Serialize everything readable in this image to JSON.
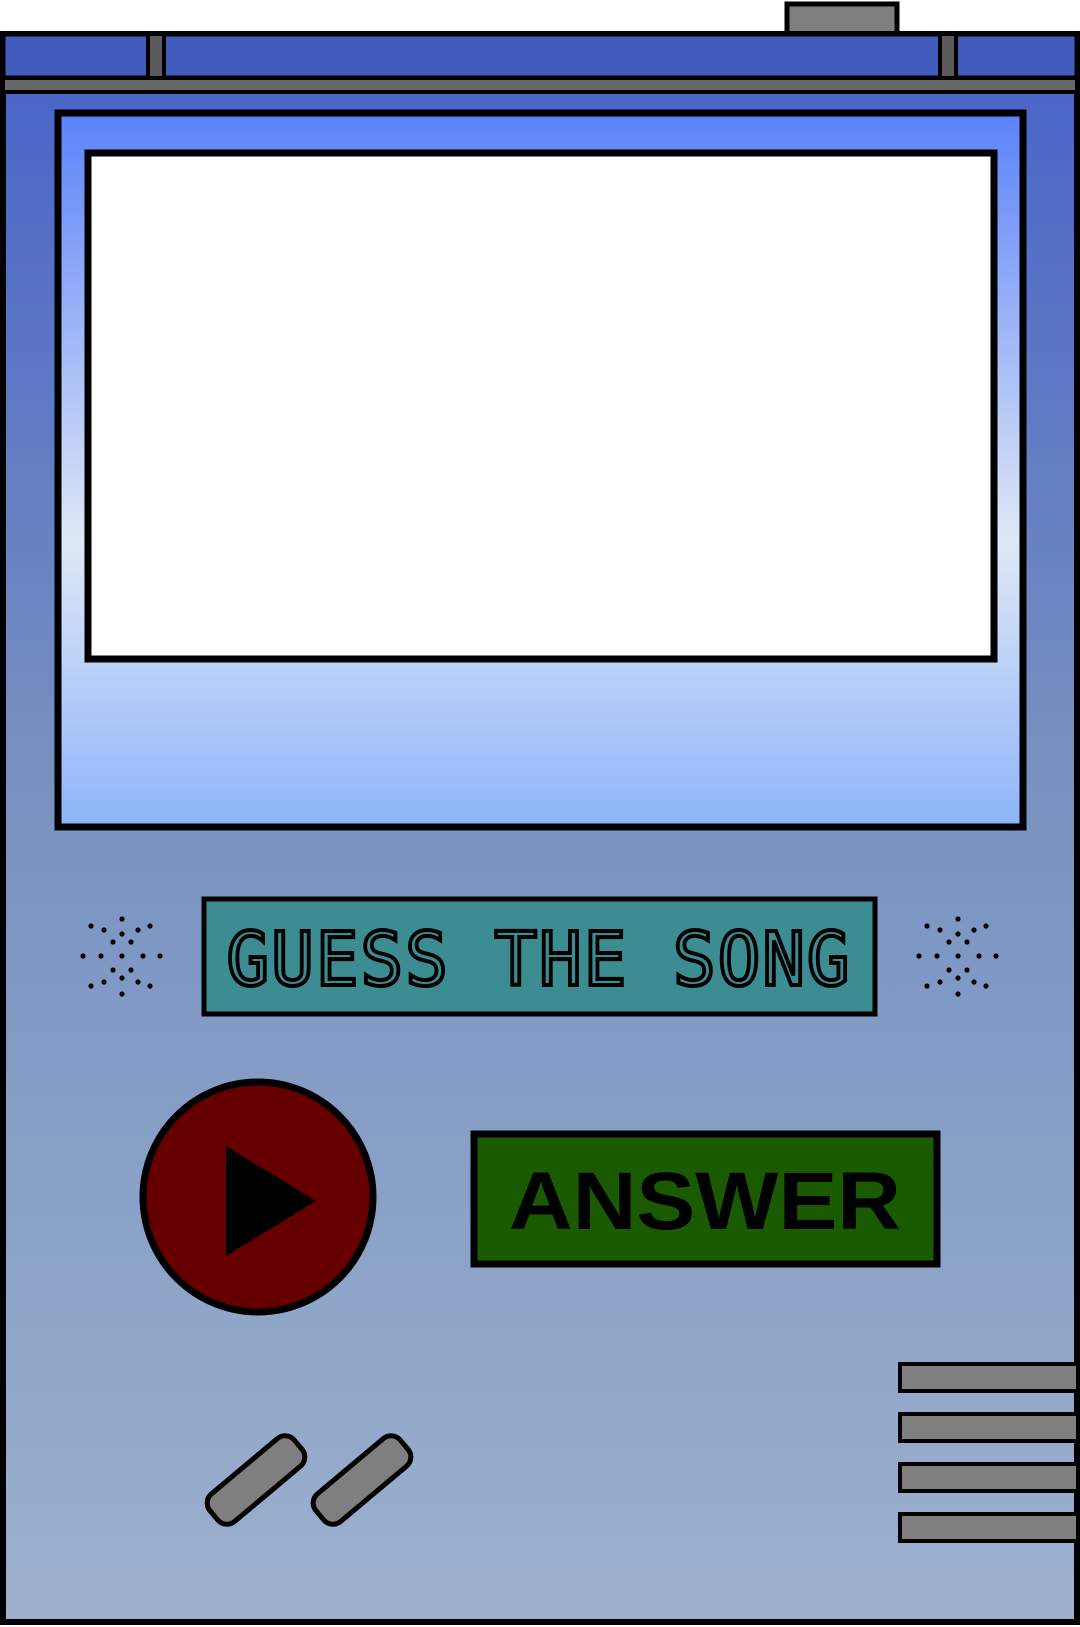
{
  "device": {
    "title_display": "GUESS THE SONG",
    "answer_label": "ANSWER",
    "icons": {
      "play": "play-icon",
      "speaker": "speaker-grille-icon"
    }
  },
  "colors": {
    "shell_top": "#4662c8",
    "shell_bottom": "#9db1ce",
    "screen_bezel_top": "#5b82fa",
    "screen_bezel_mid": "#dfe8f5",
    "screen_bezel_bottom": "#8db4fb",
    "screen": "#ffffff",
    "lcd_bg": "#3b8d92",
    "play_button": "#660000",
    "answer_button": "#1a5a00",
    "grey_parts": "#7f7f7f",
    "outline": "#000000"
  }
}
